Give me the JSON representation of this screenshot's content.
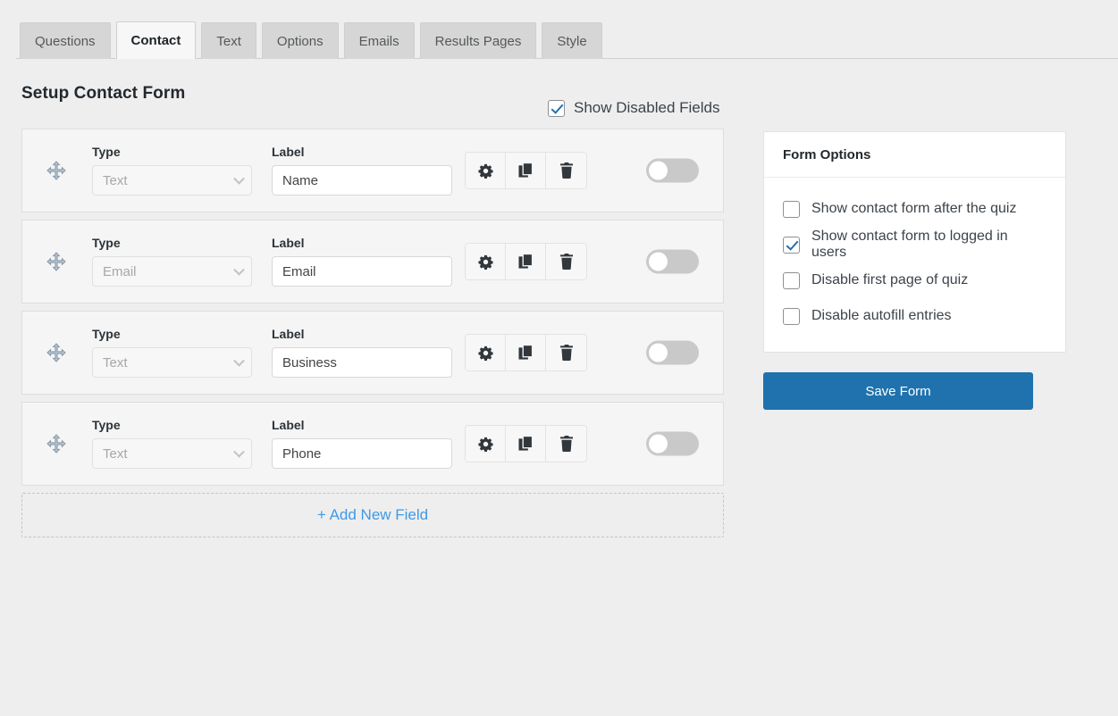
{
  "tabs": [
    {
      "label": "Questions",
      "active": false
    },
    {
      "label": "Contact",
      "active": true
    },
    {
      "label": "Text",
      "active": false
    },
    {
      "label": "Options",
      "active": false
    },
    {
      "label": "Emails",
      "active": false
    },
    {
      "label": "Results Pages",
      "active": false
    },
    {
      "label": "Style",
      "active": false
    }
  ],
  "header": {
    "title": "Setup Contact Form",
    "show_disabled_label": "Show Disabled Fields",
    "show_disabled_checked": true
  },
  "columns": {
    "type_heading": "Type",
    "label_heading": "Label"
  },
  "fields": [
    {
      "type": "Text",
      "label": "Name",
      "enabled": false
    },
    {
      "type": "Email",
      "label": "Email",
      "enabled": false
    },
    {
      "type": "Text",
      "label": "Business",
      "enabled": false
    },
    {
      "type": "Text",
      "label": "Phone",
      "enabled": false
    }
  ],
  "row_actions": {
    "settings": "gear-icon",
    "duplicate": "copy-icon",
    "delete": "trash-icon"
  },
  "add_field_label": "+ Add New Field",
  "sidebar": {
    "panel_title": "Form Options",
    "options": [
      {
        "label": "Show contact form after the quiz",
        "checked": false
      },
      {
        "label": "Show contact form to logged in users",
        "checked": true
      },
      {
        "label": "Disable first page of quiz",
        "checked": false
      },
      {
        "label": "Disable autofill entries",
        "checked": false
      }
    ],
    "save_label": "Save Form"
  },
  "colors": {
    "page_bg": "#eeeeee",
    "accent_blue": "#2271b1",
    "save_button": "#1f72ad",
    "link_blue": "#3d9ae8",
    "toggle_off": "#c9c9c9",
    "icon_dark": "#32373c"
  }
}
